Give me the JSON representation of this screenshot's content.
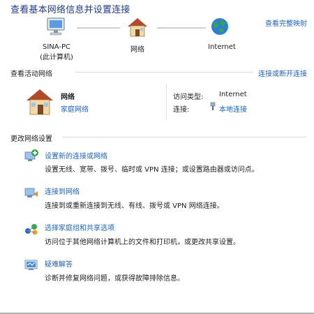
{
  "header": {
    "title": "查看基本网络信息并设置连接",
    "full_map_link": "查看完整映射"
  },
  "map": {
    "nodes": [
      {
        "label": "SINA-PC",
        "sublabel": "(此计算机)"
      },
      {
        "label": "网络"
      },
      {
        "label": "Internet"
      }
    ]
  },
  "active": {
    "heading": "查看活动网络",
    "connect_link": "连接或断开连接",
    "network_name": "网络",
    "network_type": "家庭网络",
    "access_type_label": "访问类型:",
    "access_type_value": "Internet",
    "connection_label": "连接:",
    "connection_value": "本地连接"
  },
  "change": {
    "heading": "更改网络设置",
    "tasks": [
      {
        "title": "设置新的连接或网络",
        "desc": "设置无线、宽带、拨号、临时或 VPN 连接；或设置路由器或访问点。",
        "icon": "new-connection-icon"
      },
      {
        "title": "连接到网络",
        "desc": "连接到或重新连接到无线、有线、拨号或 VPN 网络连接。",
        "icon": "connect-network-icon"
      },
      {
        "title": "选择家庭组和共享选项",
        "desc": "访问位于其他网络计算机上的文件和打印机，或更改共享设置。",
        "icon": "homegroup-icon"
      },
      {
        "title": "疑难解答",
        "desc": "诊断并修复网络问题，或获得故障排除信息。",
        "icon": "troubleshoot-icon"
      }
    ]
  }
}
